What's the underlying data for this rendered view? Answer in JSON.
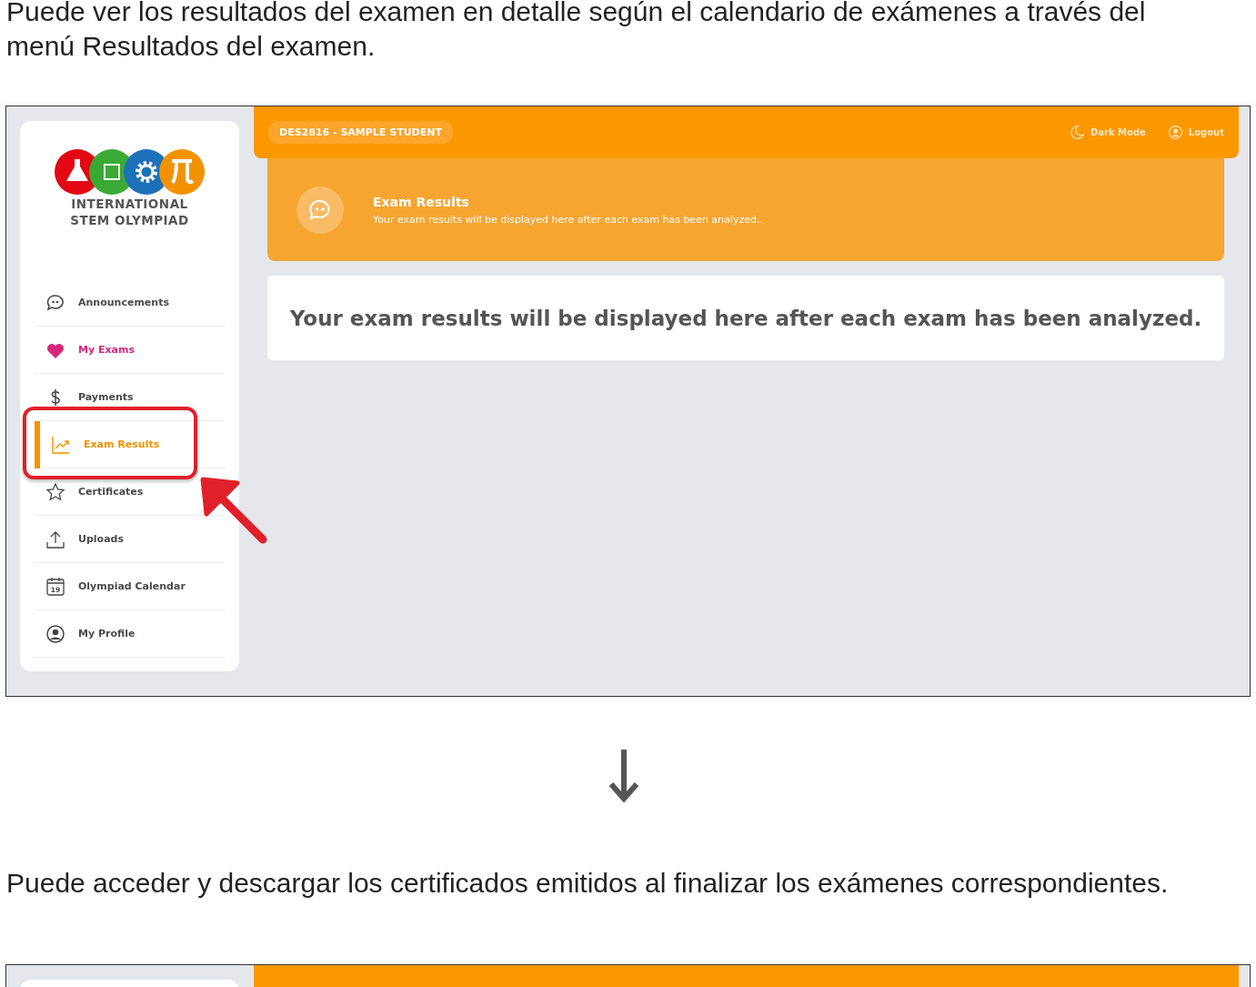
{
  "captions": [
    "Puede ver los resultados del examen en detalle según el calendario de exámenes a través del",
    "menú Resultados del examen."
  ],
  "screen": {
    "logo": {
      "lines": [
        "INTERNATIONAL",
        "STEM OLYMPIAD"
      ]
    },
    "sidebar": {
      "items": [
        {
          "label": "Announcements",
          "kind": "chat",
          "selected": false,
          "color": "#4a4a4a"
        },
        {
          "label": "My Exams",
          "kind": "heart",
          "selected": false,
          "color": "#d6287a"
        },
        {
          "label": "Payments",
          "kind": "dollar",
          "selected": false,
          "color": "#4a4a4a"
        },
        {
          "label": "Exam Results",
          "kind": "chart",
          "selected": true,
          "color": "#f39200"
        },
        {
          "label": "Certificates",
          "kind": "star",
          "selected": false,
          "color": "#4a4a4a"
        },
        {
          "label": "Uploads",
          "kind": "upload",
          "selected": false,
          "color": "#4a4a4a"
        },
        {
          "label": "Olympiad Calendar",
          "kind": "calendar",
          "icon_text": "19",
          "selected": false,
          "color": "#4a4a4a"
        },
        {
          "label": "My Profile",
          "kind": "profile",
          "selected": false,
          "color": "#4a4a4a"
        }
      ]
    },
    "top_bar": {
      "user": "DES2816 - SAMPLE STUDENT",
      "actions": [
        {
          "label": "Dark Mode",
          "kind": "moon"
        },
        {
          "label": "Logout",
          "kind": "profile"
        }
      ]
    },
    "banner": {
      "title": "Exam Results",
      "subtitle": "Your exam results will be displayed here after each exam has been analyzed.."
    },
    "message": "Your exam results will be displayed here after each exam has been analyzed."
  },
  "second_caption": "Puede acceder y descargar los certificados emitidos al finalizar los exámenes correspondientes."
}
